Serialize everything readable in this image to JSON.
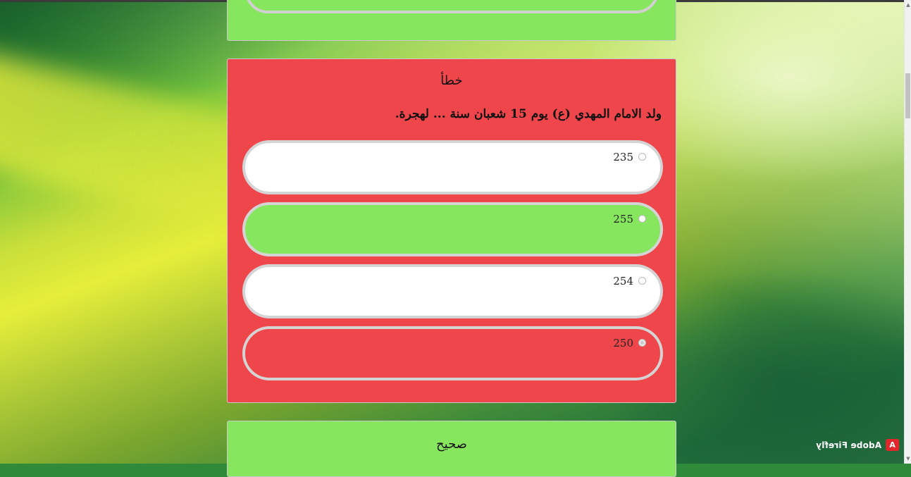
{
  "colors": {
    "correct": "#86e65e",
    "wrong": "#ef464b",
    "option_border": "#d4d4d4"
  },
  "previous_card": {
    "state": "correct"
  },
  "current_card": {
    "verdict": "خطأ",
    "question": "ولد الامام المهدي (ع) يوم 15 شعبان سنة ... لهجرة.",
    "options": [
      {
        "label": "235",
        "selected": false,
        "state": "neutral"
      },
      {
        "label": "255",
        "selected": false,
        "state": "correct"
      },
      {
        "label": "254",
        "selected": false,
        "state": "neutral"
      },
      {
        "label": "250",
        "selected": true,
        "state": "wrong"
      }
    ]
  },
  "next_card": {
    "verdict": "صحيح"
  },
  "watermark": {
    "text": "Adobe Firefly",
    "logo": "adobe-logo-icon"
  }
}
